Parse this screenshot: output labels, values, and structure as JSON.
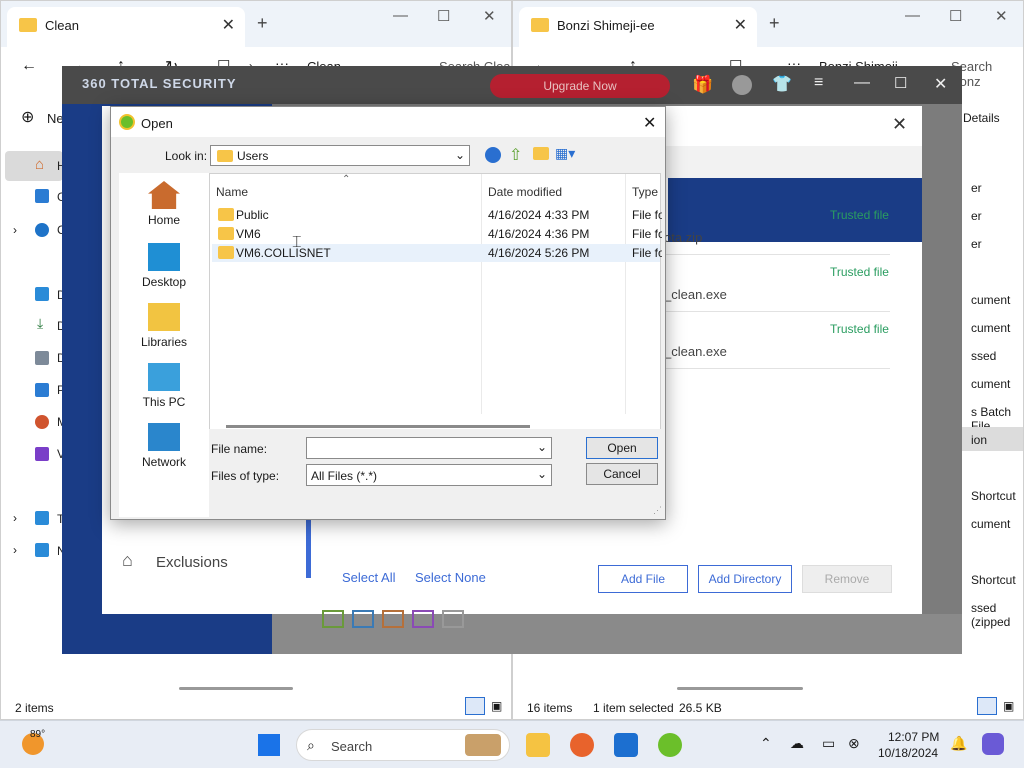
{
  "left_window": {
    "tab_title": "Clean",
    "breadcrumb": "Clean",
    "search_placeholder": "Search Clea",
    "new_label": "Ne",
    "status_items": "2 items",
    "sidebar": [
      {
        "label": "H"
      },
      {
        "label": "G"
      },
      {
        "label": "C"
      },
      {
        "label": "D"
      },
      {
        "label": "D"
      },
      {
        "label": "D"
      },
      {
        "label": "P"
      },
      {
        "label": "M"
      },
      {
        "label": "V"
      },
      {
        "label": "T"
      },
      {
        "label": "N"
      }
    ]
  },
  "right_window": {
    "tab_title": "Bonzi Shimeji-ee",
    "breadcrumb": "Bonzi Shimeji",
    "search_placeholder": "Search Bonz",
    "details_label": "Details",
    "status_items": "16 items",
    "status_selected": "1 item selected",
    "status_size": "26.5 KB",
    "list_fragments": [
      "er",
      "er",
      "er",
      "cument",
      "cument",
      "ssed",
      "cument",
      "s Batch File",
      "ion",
      "Shortcut",
      "cument",
      "Shortcut",
      "ssed (zipped"
    ]
  },
  "security": {
    "logo": "360 TOTAL SECURITY",
    "upgrade_label": "Upgrade Now",
    "exclusions_label": "Exclusions",
    "files": [
      {
        "name": "ota.zip",
        "status": "Trusted file"
      },
      {
        "name": "_clean.exe",
        "status": "Trusted file"
      },
      {
        "name": "_clean.exe",
        "status": "Trusted file"
      }
    ],
    "select_all": "Select All",
    "select_none": "Select None",
    "add_file": "Add File",
    "add_directory": "Add Directory",
    "remove": "Remove",
    "close_symbol": "✕"
  },
  "dialog": {
    "title": "Open",
    "look_in_label": "Look in:",
    "look_in_value": "Users",
    "places": [
      {
        "label": "Home"
      },
      {
        "label": "Desktop"
      },
      {
        "label": "Libraries"
      },
      {
        "label": "This PC"
      },
      {
        "label": "Network"
      }
    ],
    "columns": {
      "name": "Name",
      "date": "Date modified",
      "type": "Type"
    },
    "rows": [
      {
        "name": "Public",
        "date": "4/16/2024 4:33 PM",
        "type": "File fo"
      },
      {
        "name": "VM6",
        "date": "4/16/2024 4:36 PM",
        "type": "File fo"
      },
      {
        "name": "VM6.COLLISNET",
        "date": "4/16/2024 5:26 PM",
        "type": "File fo"
      }
    ],
    "file_name_label": "File name:",
    "file_name_value": "",
    "files_of_type_label": "Files of type:",
    "files_of_type_value": "All Files (*.*)",
    "open_label": "Open",
    "cancel_label": "Cancel"
  },
  "taskbar": {
    "weather": "89°",
    "search_label": "Search",
    "time": "12:07 PM",
    "date": "10/18/2024"
  }
}
